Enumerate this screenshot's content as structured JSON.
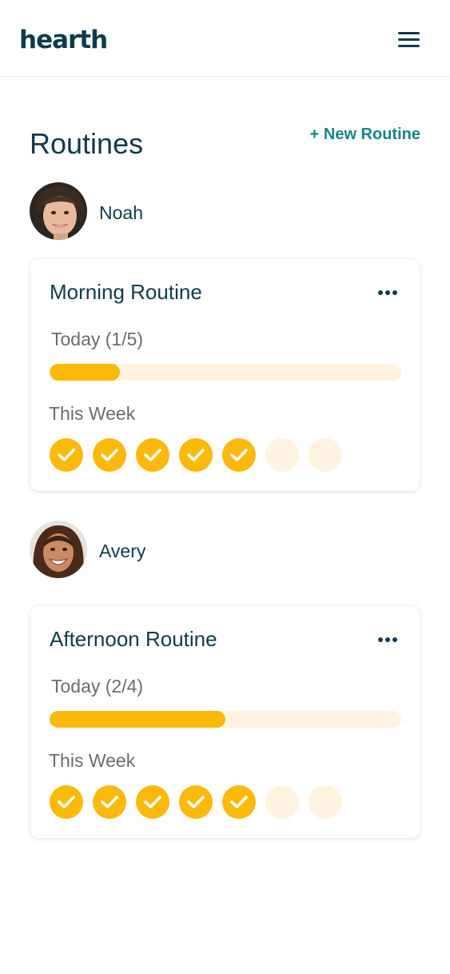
{
  "header": {
    "logo_text": "hearth",
    "menu_icon": "hamburger-menu-icon"
  },
  "page": {
    "title": "Routines",
    "new_routine_label": "+ New Routine"
  },
  "colors": {
    "brand": "#0f3b4c",
    "accent_link": "#14858c",
    "progress": "#fbb90a",
    "progress_track": "#fff2df"
  },
  "routines": [
    {
      "person": "Noah",
      "title": "Morning Routine",
      "today_label": "Today (1/5)",
      "today_completed": 1,
      "today_total": 5,
      "week_label": "This Week",
      "week_days_done": [
        true,
        true,
        true,
        true,
        true,
        false,
        false
      ]
    },
    {
      "person": "Avery",
      "title": "Afternoon Routine",
      "today_label": "Today (2/4)",
      "today_completed": 2,
      "today_total": 4,
      "week_label": "This Week",
      "week_days_done": [
        true,
        true,
        true,
        true,
        true,
        false,
        false
      ]
    }
  ]
}
